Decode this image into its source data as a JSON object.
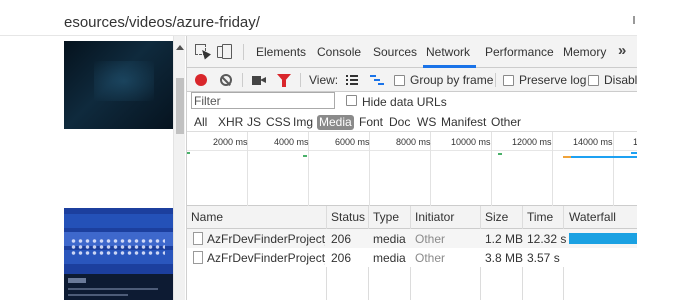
{
  "browser": {
    "url_fragment": "esources/videos/azure-friday/"
  },
  "colors": {
    "record": "#d9262b",
    "filter_icon": "#d9262b",
    "tab_accent": "#1a73e8",
    "waterfall_bar": "#1ba1e2",
    "selected_type": "#8a8a8a"
  },
  "devtools": {
    "tabs": [
      {
        "label": "Elements",
        "active": false
      },
      {
        "label": "Console",
        "active": false
      },
      {
        "label": "Sources",
        "active": false
      },
      {
        "label": "Network",
        "active": true
      },
      {
        "label": "Performance",
        "active": false
      },
      {
        "label": "Memory",
        "active": false
      }
    ],
    "more_tabs_label": "»",
    "icons": {
      "inspect": "inspect-element-icon",
      "device": "device-toolbar-icon",
      "record": "record-icon",
      "clear": "clear-icon",
      "capture": "camera-icon",
      "filter": "filter-icon",
      "list_view": "list-view-icon",
      "waterfall_view": "waterfall-view-icon"
    },
    "toolbar": {
      "view_label": "View:",
      "group_by_frame": {
        "label": "Group by frame",
        "checked": false
      },
      "preserve_log": {
        "label": "Preserve log",
        "checked": false
      },
      "disable_cache": {
        "label": "Disable",
        "checked": false
      }
    },
    "filter": {
      "placeholder": "Filter",
      "hide_data_urls": {
        "label": "Hide data URLs",
        "checked": false
      }
    },
    "type_filters": [
      {
        "label": "All",
        "selected": false
      },
      {
        "label": "XHR",
        "selected": false
      },
      {
        "label": "JS",
        "selected": false
      },
      {
        "label": "CSS",
        "selected": false
      },
      {
        "label": "Img",
        "selected": false
      },
      {
        "label": "Media",
        "selected": true
      },
      {
        "label": "Font",
        "selected": false
      },
      {
        "label": "Doc",
        "selected": false
      },
      {
        "label": "WS",
        "selected": false
      },
      {
        "label": "Manifest",
        "selected": false
      },
      {
        "label": "Other",
        "selected": false
      }
    ],
    "timeline_ticks": [
      "2000 ms",
      "4000 ms",
      "6000 ms",
      "8000 ms",
      "10000 ms",
      "12000 ms",
      "14000 ms",
      "1"
    ],
    "columns": [
      "Name",
      "Status",
      "Type",
      "Initiator",
      "Size",
      "Time",
      "Waterfall"
    ],
    "rows": [
      {
        "name": "AzFrDevFinderProject_...",
        "status": "206",
        "type": "media",
        "initiator": "Other",
        "size": "1.2 MB",
        "time": "12.32 s"
      },
      {
        "name": "AzFrDevFinderProject_...",
        "status": "206",
        "type": "media",
        "initiator": "Other",
        "size": "3.8 MB",
        "time": "3.57 s"
      }
    ]
  }
}
